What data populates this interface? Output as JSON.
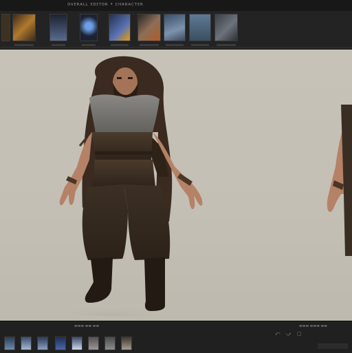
{
  "window": {
    "title": "ᴏᴠᴇʀᴀʟʟ ᴇᴅɪᴛᴏʀ • ᴄʜᴀʀᴀᴄᴛᴇʀ"
  },
  "thumbnails": [
    {
      "name": "thumb-1",
      "bg": "#6b5c3b"
    },
    {
      "name": "thumb-2",
      "bg": "#8a5a20"
    },
    {
      "name": "thumb-3",
      "bg": "#3e4a62"
    },
    {
      "name": "thumb-4",
      "bg": "#2b3854"
    },
    {
      "name": "thumb-5",
      "bg": "#37476d"
    },
    {
      "name": "thumb-6",
      "bg": "#5c4a37"
    },
    {
      "name": "thumb-7",
      "bg": "#43586f"
    },
    {
      "name": "thumb-8",
      "bg": "#4f6a80"
    },
    {
      "name": "thumb-9",
      "bg": "#474b52"
    }
  ],
  "viewport": {
    "background": "#c4c0b6"
  },
  "status": {
    "left": "▬▬▬ ▬▬ ▬▬",
    "right": "▬▬▬ ▬▬▬ ▬▬"
  },
  "controls": {
    "prev_icon": "⤺",
    "next_icon": "⤻",
    "stop_icon": "▢"
  },
  "mini_thumbs": [
    {
      "bg": "#4d6480"
    },
    {
      "bg": "#5b7aa0"
    },
    {
      "bg": "#6b84a5"
    },
    {
      "bg": "#2a3d6b"
    },
    {
      "bg": "#5c7298"
    },
    {
      "bg": "#787474"
    },
    {
      "bg": "#6d6d6d"
    },
    {
      "bg": "#8a7f72"
    }
  ]
}
